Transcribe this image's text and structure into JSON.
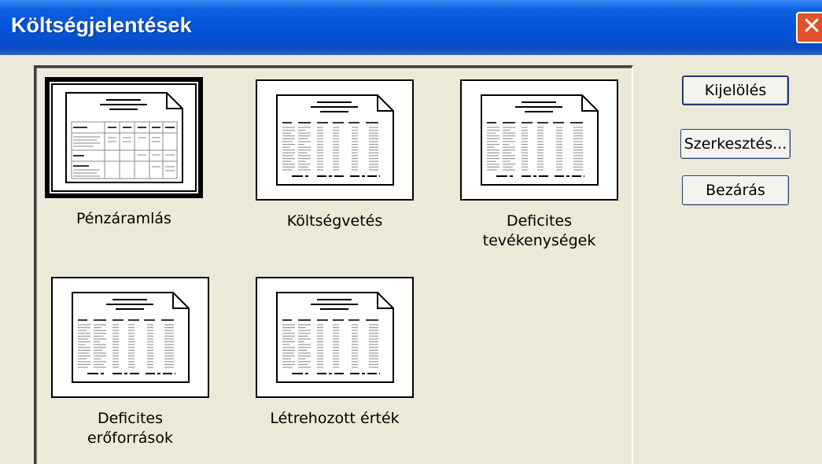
{
  "window": {
    "title": "Költségjelentések",
    "close_glyph": "✕"
  },
  "reports": [
    {
      "label_line1": "Pénzáramlás",
      "label_line2": "",
      "selected": true,
      "icon": "report-table-icon"
    },
    {
      "label_line1": "Költségvetés",
      "label_line2": "",
      "selected": false,
      "icon": "report-columns-icon"
    },
    {
      "label_line1": "Deficites",
      "label_line2": "tevékenységek",
      "selected": false,
      "icon": "report-columns-icon"
    },
    {
      "label_line1": "Deficites",
      "label_line2": "erőforrások",
      "selected": false,
      "icon": "report-columns-icon"
    },
    {
      "label_line1": "Létrehozott érték",
      "label_line2": "",
      "selected": false,
      "icon": "report-columns-icon"
    }
  ],
  "buttons": {
    "select": "Kijelölés",
    "edit": "Szerkesztés...",
    "close": "Bezárás"
  }
}
